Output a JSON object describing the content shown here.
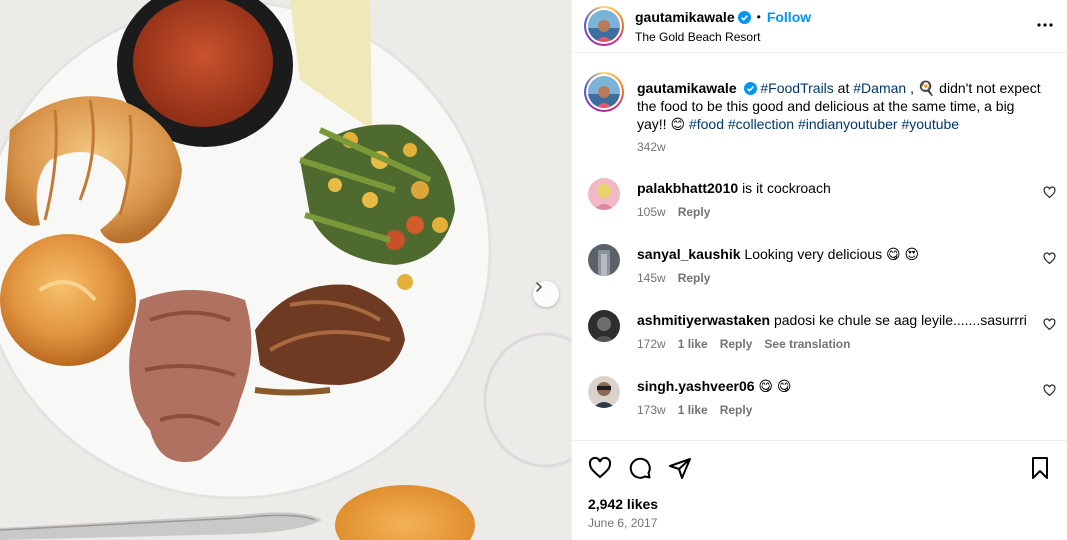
{
  "post": {
    "username": "gautamikawale",
    "follow_label": "Follow",
    "location": "The Gold Beach Resort",
    "dot": "•"
  },
  "caption": {
    "username": "gautamikawale",
    "tag1": "#FoodTrails",
    "at": " at ",
    "tag2": "#Daman",
    "text1": " ,  🍳 didn't not expect the food to be this good and delicious at the same time, a big yay!! 😊 ",
    "tag3": "#food",
    "tag4": "#collection",
    "tag5": "#indianyoutuber",
    "tag6": "#youtube",
    "time": "342w"
  },
  "comments": [
    {
      "username": "palakbhatt2010",
      "text": "is it cockroach",
      "time": "105w",
      "likes": "",
      "reply": "Reply",
      "translate": ""
    },
    {
      "username": "sanyal_kaushik",
      "text": "Looking very delicious 😋 😍",
      "time": "145w",
      "likes": "",
      "reply": "Reply",
      "translate": ""
    },
    {
      "username": "ashmitiyerwastaken",
      "text": "padosi ke chule se aag leyile.......sasurrri",
      "time": "172w",
      "likes": "1 like",
      "reply": "Reply",
      "translate": "See translation"
    },
    {
      "username": "singh.yashveer06",
      "text": "😋 😋",
      "time": "173w",
      "likes": "1 like",
      "reply": "Reply",
      "translate": ""
    }
  ],
  "footer": {
    "likes": "2,942 likes",
    "date": "June 6, 2017"
  },
  "colors": {
    "follow": "#0095f6",
    "hashtag": "#00376b",
    "verified": "#0095f6",
    "muted": "#737373"
  },
  "icons": {
    "heart": "heart-icon",
    "comment": "comment-icon",
    "share": "share-icon",
    "save": "bookmark-icon",
    "more": "more-options-icon",
    "next": "chevron-right-icon"
  }
}
